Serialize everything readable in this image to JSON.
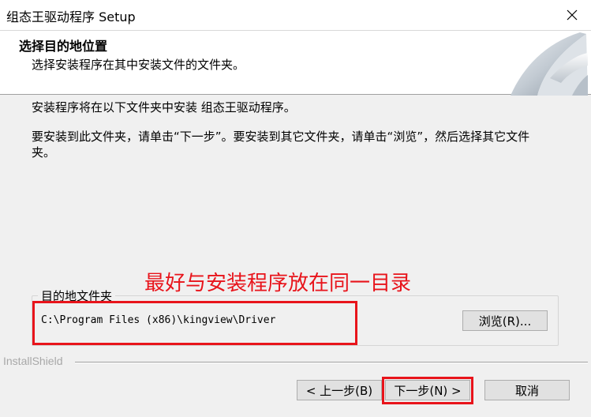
{
  "window": {
    "title": "组态王驱动程序 Setup",
    "close_icon": "close-icon"
  },
  "header": {
    "title": "选择目的地位置",
    "subtitle": "选择安装程序在其中安装文件的文件夹。"
  },
  "body": {
    "line1": "安装程序将在以下文件夹中安装 组态王驱动程序。",
    "line2": "要安装到此文件夹，请单击“下一步”。要安装到其它文件夹，请单击“浏览”，然后选择其它文件夹。"
  },
  "annotation": {
    "text": "最好与安装程序放在同一目录",
    "color": "#e8141b"
  },
  "destination": {
    "group_label": "目的地文件夹",
    "path": "C:\\Program Files (x86)\\kingview\\Driver",
    "browse_label": "浏览(R)..."
  },
  "footer": {
    "brand": "InstallShield",
    "back_label": "< 上一步(B)",
    "next_label": "下一步(N) >",
    "cancel_label": "取消"
  }
}
